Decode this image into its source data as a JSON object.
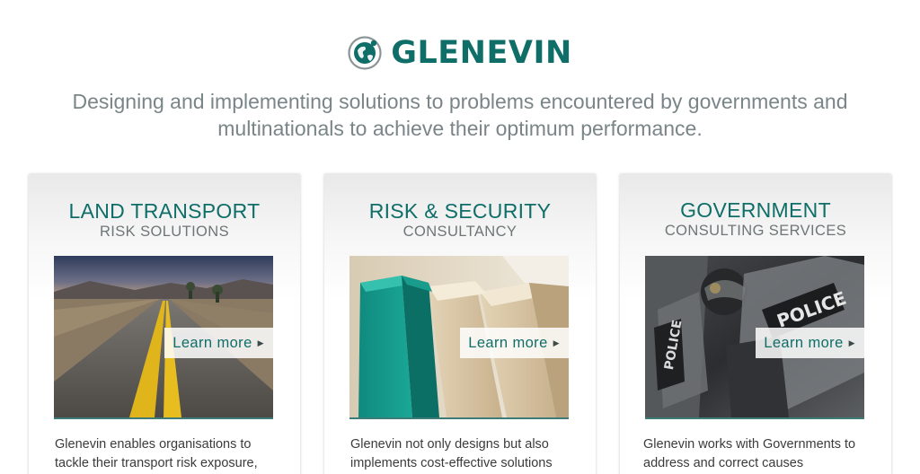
{
  "header": {
    "logo_text": "GLENEVIN",
    "tagline": "Designing and implementing solutions to problems encountered by governments and multinationals to achieve their optimum performance."
  },
  "colors": {
    "brand": "#0f6e68",
    "tagline": "#7a8587",
    "body_text": "#3b3b3b"
  },
  "cards": [
    {
      "title": "LAND TRANSPORT",
      "subtitle": "RISK SOLUTIONS",
      "image_icon": "road-photo",
      "link_label": "Learn more",
      "body": "Glenevin enables organisations to tackle their transport risk exposure,"
    },
    {
      "title": "RISK & SECURITY",
      "subtitle": "CONSULTANCY",
      "image_icon": "wooden-blocks-photo",
      "link_label": "Learn more",
      "body": "Glenevin not only designs but also implements cost-effective solutions"
    },
    {
      "title": "GOVERNMENT",
      "subtitle": "CONSULTING SERVICES",
      "image_icon": "riot-police-photo",
      "link_label": "Learn more",
      "body": "Glenevin works with Governments to address and correct causes"
    }
  ]
}
